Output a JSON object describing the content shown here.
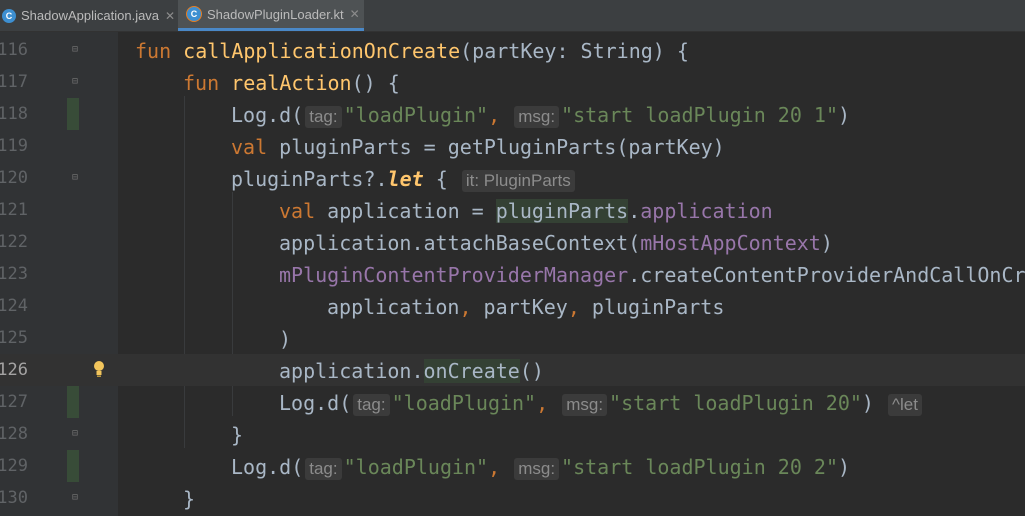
{
  "tabs": [
    {
      "label": "ShadowApplication.java",
      "icon": "java-class-icon",
      "active": false
    },
    {
      "label": "ShadowPluginLoader.kt",
      "icon": "kotlin-class-icon",
      "active": true
    }
  ],
  "lines": [
    {
      "num": "116"
    },
    {
      "num": "117"
    },
    {
      "num": "118"
    },
    {
      "num": "119"
    },
    {
      "num": "120"
    },
    {
      "num": "121"
    },
    {
      "num": "122"
    },
    {
      "num": "123"
    },
    {
      "num": "124"
    },
    {
      "num": "125"
    },
    {
      "num": "126"
    },
    {
      "num": "127"
    },
    {
      "num": "128"
    },
    {
      "num": "129"
    },
    {
      "num": "130"
    }
  ],
  "code": {
    "l116": {
      "kw": "fun",
      "fn": "callApplicationOnCreate",
      "rest": "(partKey: String) {"
    },
    "l117": {
      "kw": "fun",
      "fn": "realAction",
      "rest": "() {"
    },
    "l118": {
      "pre": "Log.d(",
      "hint1": "tag:",
      "s1": "\"loadPlugin\"",
      "comma": ",",
      "hint2": "msg:",
      "s2": "\"start loadPlugin 20 1\"",
      "post": ")"
    },
    "l119": {
      "kw": "val",
      "rest": "pluginParts = getPluginParts(partKey)"
    },
    "l120": {
      "pre": "pluginParts?.",
      "let": "let",
      "post": "{",
      "hint": "it: PluginParts"
    },
    "l121": {
      "kw": "val",
      "a": "application = ",
      "b": "pluginParts",
      "c": ".",
      "d": "application"
    },
    "l122": {
      "a": "application.attachBaseContext(",
      "b": "mHostAppContext",
      "c": ")"
    },
    "l123": {
      "a": "mPluginContentProviderManager",
      "b": ".createContentProviderAndCallOnCre"
    },
    "l124": {
      "a": "application",
      "c1": ",",
      "b": " partKey",
      "c2": ",",
      "d": " pluginParts"
    },
    "l125": {
      "a": ")"
    },
    "l126": {
      "a": "application.",
      "b": "onCreate",
      "c": "()"
    },
    "l127": {
      "pre": "Log.d(",
      "hint1": "tag:",
      "s1": "\"loadPlugin\"",
      "comma": ",",
      "hint2": "msg:",
      "s2": "\"start loadPlugin 20\"",
      "post": ")",
      "hint3": "^let"
    },
    "l128": {
      "a": "}"
    },
    "l129": {
      "pre": "Log.d(",
      "hint1": "tag:",
      "s1": "\"loadPlugin\"",
      "comma": ",",
      "hint2": "msg:",
      "s2": "\"start loadPlugin 20 2\"",
      "post": ")"
    },
    "l130": {
      "a": "}"
    }
  }
}
